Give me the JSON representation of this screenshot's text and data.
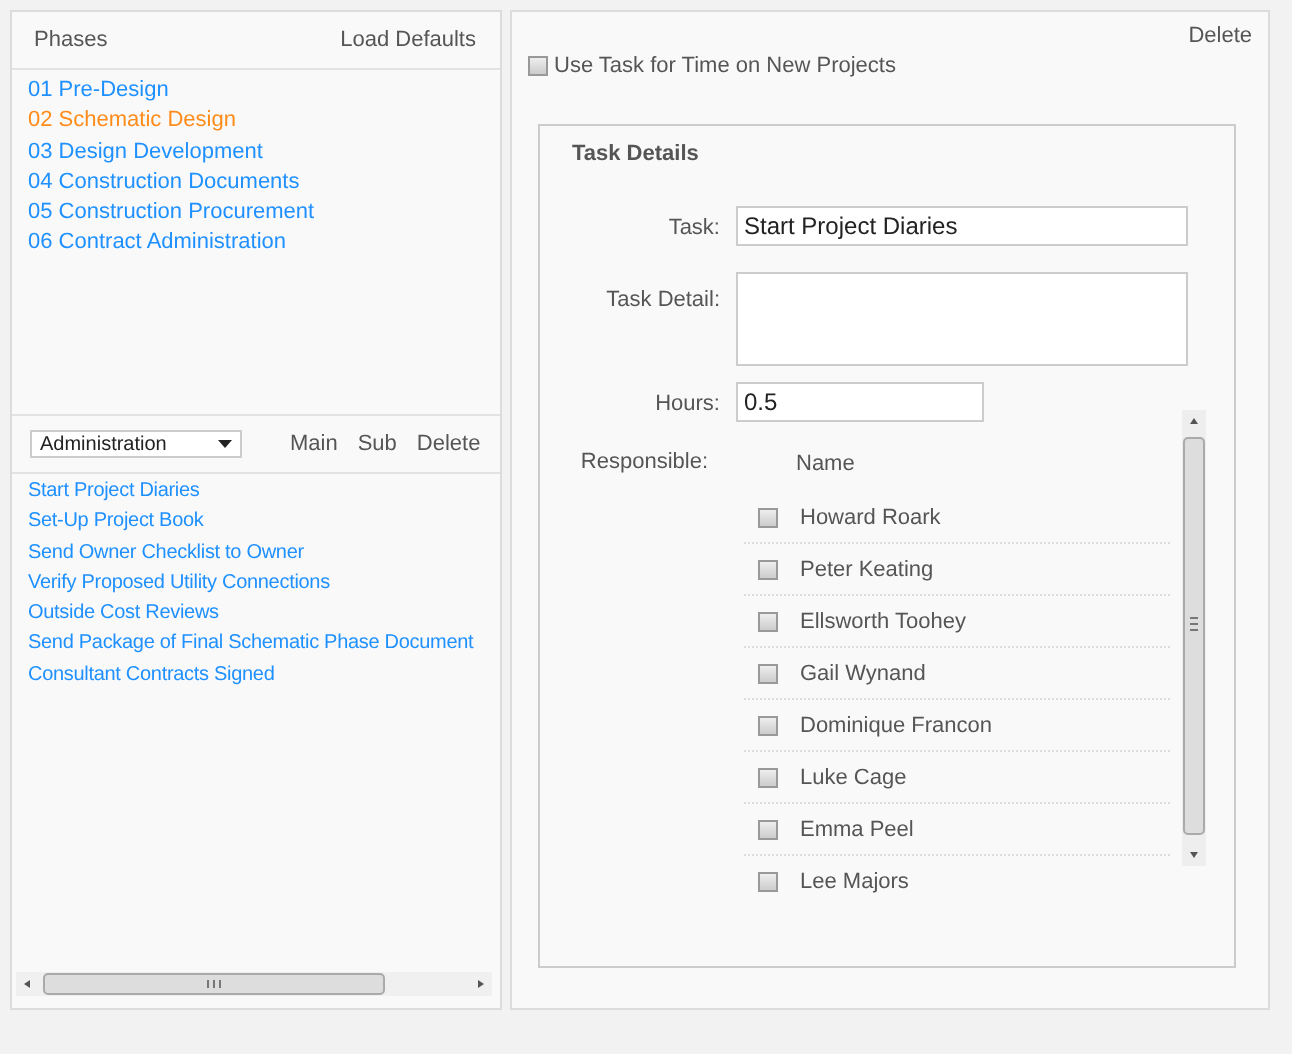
{
  "phases_panel": {
    "title": "Phases",
    "action": "Load Defaults",
    "phases": [
      {
        "label": "01 Pre-Design",
        "selected": false
      },
      {
        "label": "02 Schematic Design",
        "selected": true
      },
      {
        "label": "03 Design Development",
        "selected": false
      },
      {
        "label": "04 Construction Documents",
        "selected": false
      },
      {
        "label": "05 Construction Procurement",
        "selected": false
      },
      {
        "label": "06 Contract Administration",
        "selected": false
      }
    ]
  },
  "task_toolbar": {
    "category": "Administration",
    "buttons": [
      "Main",
      "Sub",
      "Delete"
    ]
  },
  "tasks": [
    "Start Project Diaries",
    "Set-Up Project Book",
    "Send Owner Checklist to Owner",
    "Verify Proposed Utility Connections",
    "Outside Cost Reviews",
    "Send Package of Final Schematic Phase Document",
    "Consultant Contracts Signed"
  ],
  "detail_panel": {
    "delete": "Delete",
    "use_task_option": {
      "label": "Use Task for Time on New Projects",
      "checked": false
    },
    "group_title": "Task Details",
    "task": {
      "label": "Task:",
      "value": "Start Project Diaries"
    },
    "task_detail": {
      "label": "Task Detail:"
    },
    "hours": {
      "label": "Hours:",
      "value": "0.5"
    },
    "responsible": {
      "label": "Responsible:",
      "column": "Name",
      "people": [
        {
          "name": "Howard Roark",
          "checked": false
        },
        {
          "name": "Peter Keating",
          "checked": false
        },
        {
          "name": "Ellsworth Toohey",
          "checked": false
        },
        {
          "name": "Gail Wynand",
          "checked": false
        },
        {
          "name": "Dominique Francon",
          "checked": false
        },
        {
          "name": "Luke Cage",
          "checked": false
        },
        {
          "name": "Emma Peel",
          "checked": false
        },
        {
          "name": "Lee Majors",
          "checked": false
        }
      ]
    }
  }
}
